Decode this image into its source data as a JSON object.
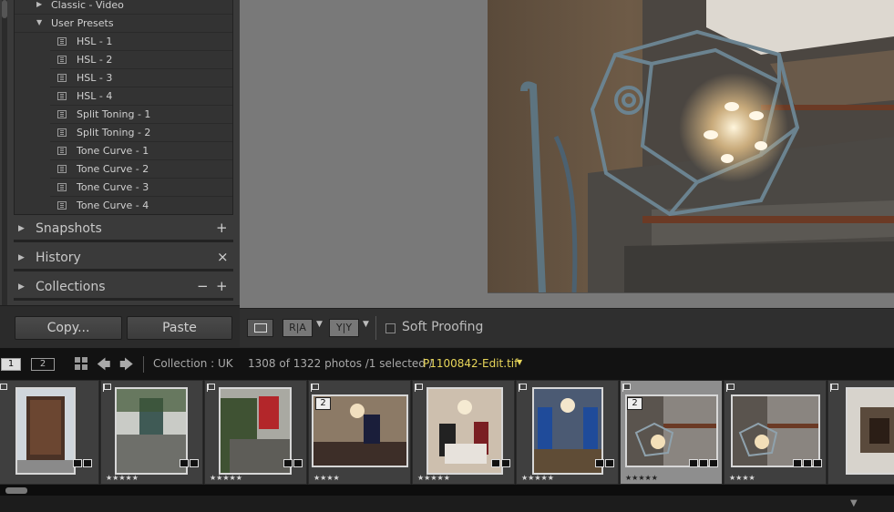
{
  "presets": {
    "folders": [
      {
        "label": "Classic - Video",
        "expanded": false
      },
      {
        "label": "User Presets",
        "expanded": true
      }
    ],
    "items": [
      "HSL - 1",
      "HSL - 2",
      "HSL - 3",
      "HSL - 4",
      "Split Toning - 1",
      "Split Toning - 2",
      "Tone Curve - 1",
      "Tone Curve - 2",
      "Tone Curve - 3",
      "Tone Curve - 4"
    ]
  },
  "panels": {
    "snapshots": {
      "label": "Snapshots",
      "action": "+"
    },
    "history": {
      "label": "History",
      "action": "×"
    },
    "collections": {
      "label": "Collections",
      "action_minus": "−",
      "action_plus": "+"
    }
  },
  "buttons": {
    "copy": "Copy...",
    "paste": "Paste"
  },
  "toolbar": {
    "before_after_label": "R|A",
    "before_after_split_label": "Y|Y",
    "soft_proofing": "Soft Proofing",
    "soft_proofing_checked": false
  },
  "filmbar": {
    "monitor_1": "1",
    "monitor_2": "2",
    "collection": "Collection : UK",
    "count": "1308 of 1322 photos /1 selected /",
    "filename": "P1100842-Edit.tif",
    "filename_color": "#e8d65a"
  },
  "filmstrip": [
    {
      "stars": "",
      "stack": ""
    },
    {
      "stars": "★★★★★",
      "stack": ""
    },
    {
      "stars": "★★★★★",
      "stack": ""
    },
    {
      "stars": "★★★★",
      "stack": "2"
    },
    {
      "stars": "★★★★★",
      "stack": ""
    },
    {
      "stars": "★★★★★",
      "stack": ""
    },
    {
      "stars": "★★★★★",
      "stack": "2",
      "selected": true
    },
    {
      "stars": "★★★★",
      "stack": ""
    },
    {
      "stars": "",
      "stack": ""
    }
  ]
}
